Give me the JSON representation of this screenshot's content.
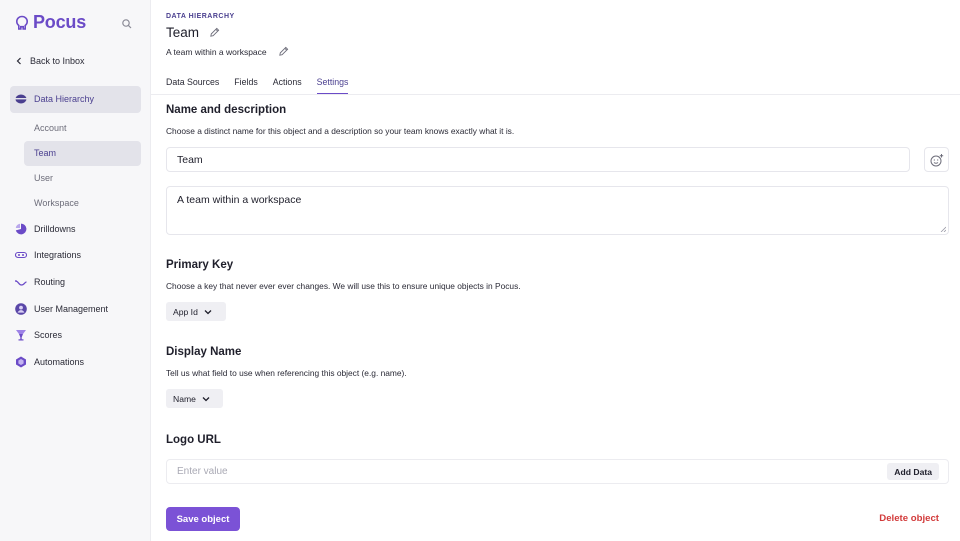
{
  "brand": {
    "name": "Pocus",
    "accent": "#7b52d6",
    "danger": "#d23a3a"
  },
  "sidebar": {
    "back_label": "Back to Inbox",
    "items": [
      {
        "label": "Data Hierarchy",
        "icon": "data-hierarchy-icon"
      },
      {
        "label": "Drilldowns",
        "icon": "pie-chart-icon"
      },
      {
        "label": "Integrations",
        "icon": "integrations-icon"
      },
      {
        "label": "Routing",
        "icon": "routing-icon"
      },
      {
        "label": "User Management",
        "icon": "user-icon"
      },
      {
        "label": "Scores",
        "icon": "trophy-icon"
      },
      {
        "label": "Automations",
        "icon": "automations-icon"
      }
    ],
    "subitems": [
      {
        "label": "Account"
      },
      {
        "label": "Team"
      },
      {
        "label": "User"
      },
      {
        "label": "Workspace"
      }
    ]
  },
  "header": {
    "breadcrumb": "Data Hierarchy",
    "title": "Team",
    "subtitle": "A team within a workspace"
  },
  "tabs": [
    {
      "label": "Data Sources"
    },
    {
      "label": "Fields"
    },
    {
      "label": "Actions"
    },
    {
      "label": "Settings"
    }
  ],
  "sections": {
    "name": {
      "title": "Name and description",
      "desc": "Choose a distinct name for this object and a description so your team knows exactly what it is.",
      "name_value": "Team",
      "description_value": "A team within a workspace"
    },
    "primary_key": {
      "title": "Primary Key",
      "desc": "Choose a key that never ever ever changes. We will use this to ensure unique objects in Pocus.",
      "value": "App Id"
    },
    "display_name": {
      "title": "Display Name",
      "desc": "Tell us what field to use when referencing this object (e.g. name).",
      "value": "Name"
    },
    "logo_url": {
      "title": "Logo URL",
      "placeholder": "Enter value",
      "add_label": "Add Data"
    }
  },
  "actions": {
    "save_label": "Save object",
    "delete_label": "Delete object"
  }
}
